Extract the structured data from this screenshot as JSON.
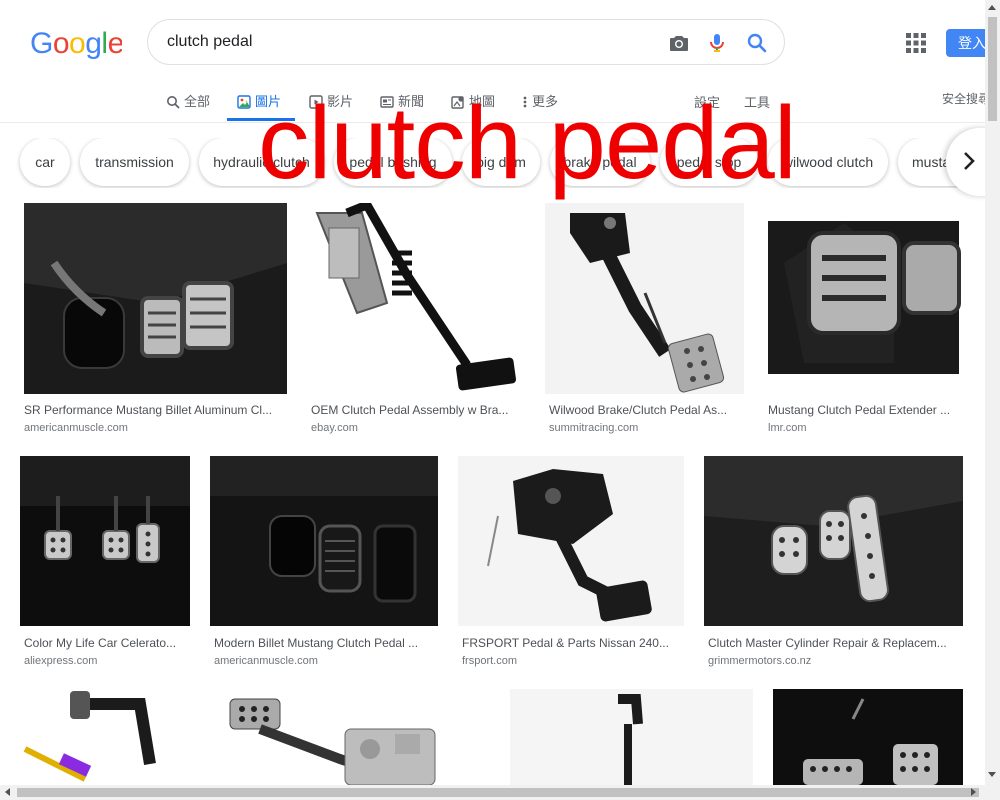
{
  "search": {
    "query": "clutch pedal"
  },
  "header": {
    "signin_label": "登入"
  },
  "tabs": [
    {
      "label": "全部",
      "icon": "search-icon"
    },
    {
      "label": "圖片",
      "icon": "image-icon"
    },
    {
      "label": "影片",
      "icon": "video-icon"
    },
    {
      "label": "新聞",
      "icon": "news-icon"
    },
    {
      "label": "地圖",
      "icon": "map-icon"
    },
    {
      "label": "更多",
      "icon": "more-icon"
    }
  ],
  "tools": {
    "settings": "設定",
    "tools": "工具",
    "safesearch": "安全搜尋"
  },
  "chips": [
    "car",
    "transmission",
    "hydraulic clutch",
    "pedal bushing",
    "big dam",
    "brake pedal",
    "pedal stop",
    "wilwood clutch",
    "mustang"
  ],
  "overlay_text": "clutch pedal",
  "results": [
    {
      "title": "SR Performance Mustang Billet Aluminum Cl...",
      "domain": "americanmuscle.com"
    },
    {
      "title": "OEM Clutch Pedal Assembly w Bra...",
      "domain": "ebay.com"
    },
    {
      "title": "Wilwood Brake/Clutch Pedal As...",
      "domain": "summitracing.com"
    },
    {
      "title": "Mustang Clutch Pedal Extender ...",
      "domain": "lmr.com"
    },
    {
      "title": "Color My Life Car Celerato...",
      "domain": "aliexpress.com"
    },
    {
      "title": "Modern Billet Mustang Clutch Pedal ...",
      "domain": "americanmuscle.com"
    },
    {
      "title": "FRSPORT Pedal & Parts Nissan 240...",
      "domain": "frsport.com"
    },
    {
      "title": "Clutch Master Cylinder Repair & Replacem...",
      "domain": "grimmermotors.co.nz"
    }
  ],
  "colors": {
    "accent": "#1a73e8",
    "overlay": "#ee0000",
    "signin": "#4285f4"
  }
}
